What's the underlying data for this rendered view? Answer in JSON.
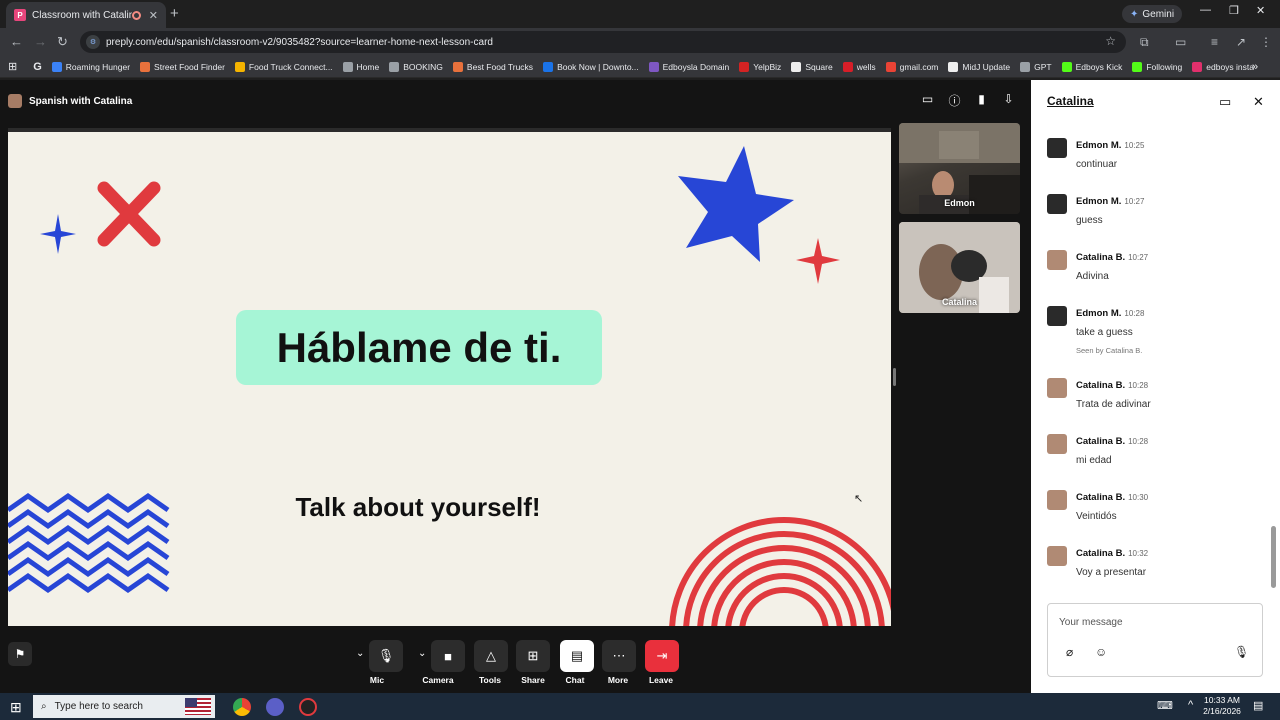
{
  "browser": {
    "tab_title": "Classroom with Catalina",
    "tab_favicon": "P",
    "gemini_label": "Gemini",
    "url": "preply.com/edu/spanish/classroom-v2/9035482?source=learner-home-next-lesson-card",
    "bookmarks": [
      {
        "label": "Roaming Hunger",
        "color": "#3b82f6"
      },
      {
        "label": "Street Food Finder",
        "color": "#e8713c"
      },
      {
        "label": "Food Truck Connect...",
        "color": "#f5b400"
      },
      {
        "label": "Home",
        "color": "#9aa0a6"
      },
      {
        "label": "BOOKING",
        "color": "#9aa0a6"
      },
      {
        "label": "Best Food Trucks",
        "color": "#e8713c"
      },
      {
        "label": "Book Now | Downto...",
        "color": "#1a73e8"
      },
      {
        "label": "Edboysla Domain",
        "color": "#7e57c2"
      },
      {
        "label": "YelpBiz",
        "color": "#d32323"
      },
      {
        "label": "Square",
        "color": "#eeeeee"
      },
      {
        "label": "wells",
        "color": "#d71e28"
      },
      {
        "label": "gmail.com",
        "color": "#ea4335"
      },
      {
        "label": "MidJ Update",
        "color": "#eeeeee"
      },
      {
        "label": "GPT",
        "color": "#9aa0a6"
      },
      {
        "label": "Edboys Kick",
        "color": "#53fc18"
      },
      {
        "label": "Following",
        "color": "#53fc18"
      },
      {
        "label": "edboys insta",
        "color": "#e1306c"
      }
    ]
  },
  "lesson": {
    "title": "Spanish with Catalina"
  },
  "slide": {
    "heading": "Háblame de ti.",
    "subheading": "Talk about yourself!",
    "colors": {
      "background": "#f3f1e8",
      "title_box": "#a6f5d6",
      "red": "#e03a3e",
      "blue": "#2746d6"
    }
  },
  "videos": {
    "student_name": "Edmon",
    "tutor_name": "Catalina"
  },
  "controls": {
    "mic": "Mic",
    "camera": "Camera",
    "tools": "Tools",
    "share": "Share",
    "chat": "Chat",
    "more": "More",
    "leave": "Leave"
  },
  "chat": {
    "header": "Catalina",
    "seen_text": "Seen by Catalina B.",
    "placeholder": "Your message",
    "messages": [
      {
        "name": "Edmon M.",
        "time": "10:25",
        "text": "continuar",
        "avatar_color": "#2a2a2a"
      },
      {
        "name": "Edmon M.",
        "time": "10:27",
        "text": "guess",
        "avatar_color": "#2a2a2a"
      },
      {
        "name": "Catalina B.",
        "time": "10:27",
        "text": "Adivina",
        "avatar_color": "#b08a74"
      },
      {
        "name": "Edmon M.",
        "time": "10:28",
        "text": "take a guess",
        "avatar_color": "#2a2a2a"
      },
      {
        "name": "Catalina B.",
        "time": "10:28",
        "text": "Trata de adivinar",
        "avatar_color": "#b08a74"
      },
      {
        "name": "Catalina B.",
        "time": "10:28",
        "text": "mi edad",
        "avatar_color": "#b08a74"
      },
      {
        "name": "Catalina B.",
        "time": "10:30",
        "text": "Veintidós",
        "avatar_color": "#b08a74"
      },
      {
        "name": "Catalina B.",
        "time": "10:32",
        "text": "Voy a presentar",
        "avatar_color": "#b08a74"
      }
    ]
  },
  "taskbar": {
    "search_placeholder": "Type here to search",
    "time": "10:33 AM",
    "date": "2/16/2026"
  }
}
